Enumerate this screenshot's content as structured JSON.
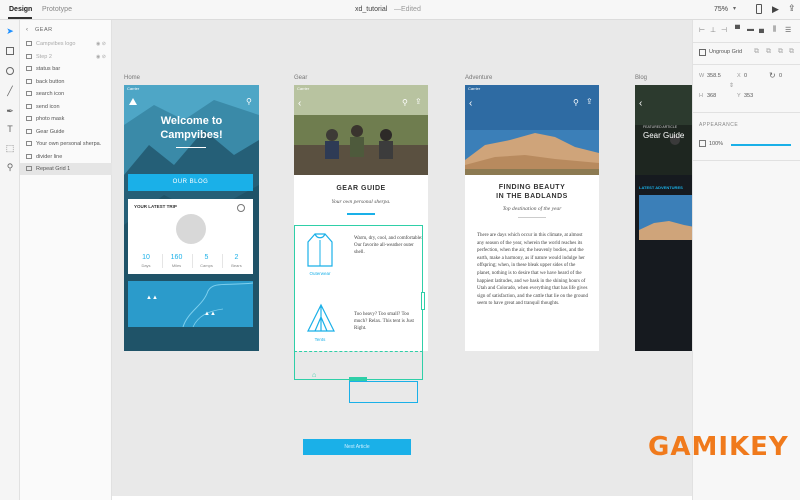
{
  "topbar": {
    "tabs": [
      "Design",
      "Prototype"
    ],
    "doc_name": "xd_tutorial",
    "status": "Edited",
    "zoom": "75%"
  },
  "layers": {
    "header": "GEAR",
    "items": [
      {
        "label": "Campvibes logo",
        "dim": true
      },
      {
        "label": "Step 2",
        "dim": true
      },
      {
        "label": "status bar"
      },
      {
        "label": "back button"
      },
      {
        "label": "search icon"
      },
      {
        "label": "send icon"
      },
      {
        "label": "photo mask"
      },
      {
        "label": "Gear Guide"
      },
      {
        "label": "Your own personal sherpa."
      },
      {
        "label": "divider line"
      },
      {
        "label": "Repeat Grid 1",
        "selected": true
      }
    ]
  },
  "canvas": {
    "artboards": [
      "Home",
      "Gear",
      "Adventure",
      "Blog"
    ],
    "home": {
      "status": "Carrier",
      "title_line1": "Welcome to",
      "title_line2": "Campvibes!",
      "button": "OUR BLOG",
      "trip_title": "YOUR LATEST TRIP",
      "stats": [
        {
          "value": "10",
          "label": "Days"
        },
        {
          "value": "160",
          "label": "Miles"
        },
        {
          "value": "5",
          "label": "Camps"
        },
        {
          "value": "2",
          "label": "Bears"
        }
      ]
    },
    "gear": {
      "status": "Carrier",
      "title": "GEAR GUIDE",
      "subtitle": "Your own personal sherpa.",
      "items": [
        {
          "label": "Outerwear",
          "text": "Warm, dry, cool, and comfortable: Our favorite all-weather outer shell."
        },
        {
          "label": "Tents",
          "text": "Too heavy? Too small? Too much? Relax. This tent is Just Right."
        }
      ]
    },
    "adventure": {
      "status": "Carrier",
      "title_line1": "FINDING BEAUTY",
      "title_line2": "IN THE BADLANDS",
      "subtitle": "Top destination of the year",
      "body": "There are days which occur in this climate, at almost any season of the year, wherein the world reaches its perfection, when the air, the heavenly bodies, and the earth, make a harmony, as if nature would indulge her offspring; when, in these bleak upper sides of the planet, nothing is to desire that we have heard of the happiest latitudes, and we bask in the shining hours of Utah and Colorado, when everything that has life gives sign of satisfaction, and the cattle that lie on the ground seem to have great and tranquil thoughts."
    },
    "blog": {
      "featured": "FEATURED ARTICLE",
      "title": "Gear Guide",
      "latest": "LATEST ADVENTURES"
    },
    "next_article": "Next Article"
  },
  "props": {
    "ungroup": "Ungroup Grid",
    "w_label": "W",
    "w": "358.5",
    "x_label": "X",
    "x": "0",
    "rot": "0",
    "h_label": "H",
    "h": "368",
    "y_label": "Y",
    "y": "353",
    "appearance": "APPEARANCE",
    "opacity": "100%"
  },
  "watermark": "GAMIKEY",
  "colors": {
    "accent": "#1ab0e8",
    "selection": "#2fcfa8",
    "home_bg": "#2f7c96"
  }
}
